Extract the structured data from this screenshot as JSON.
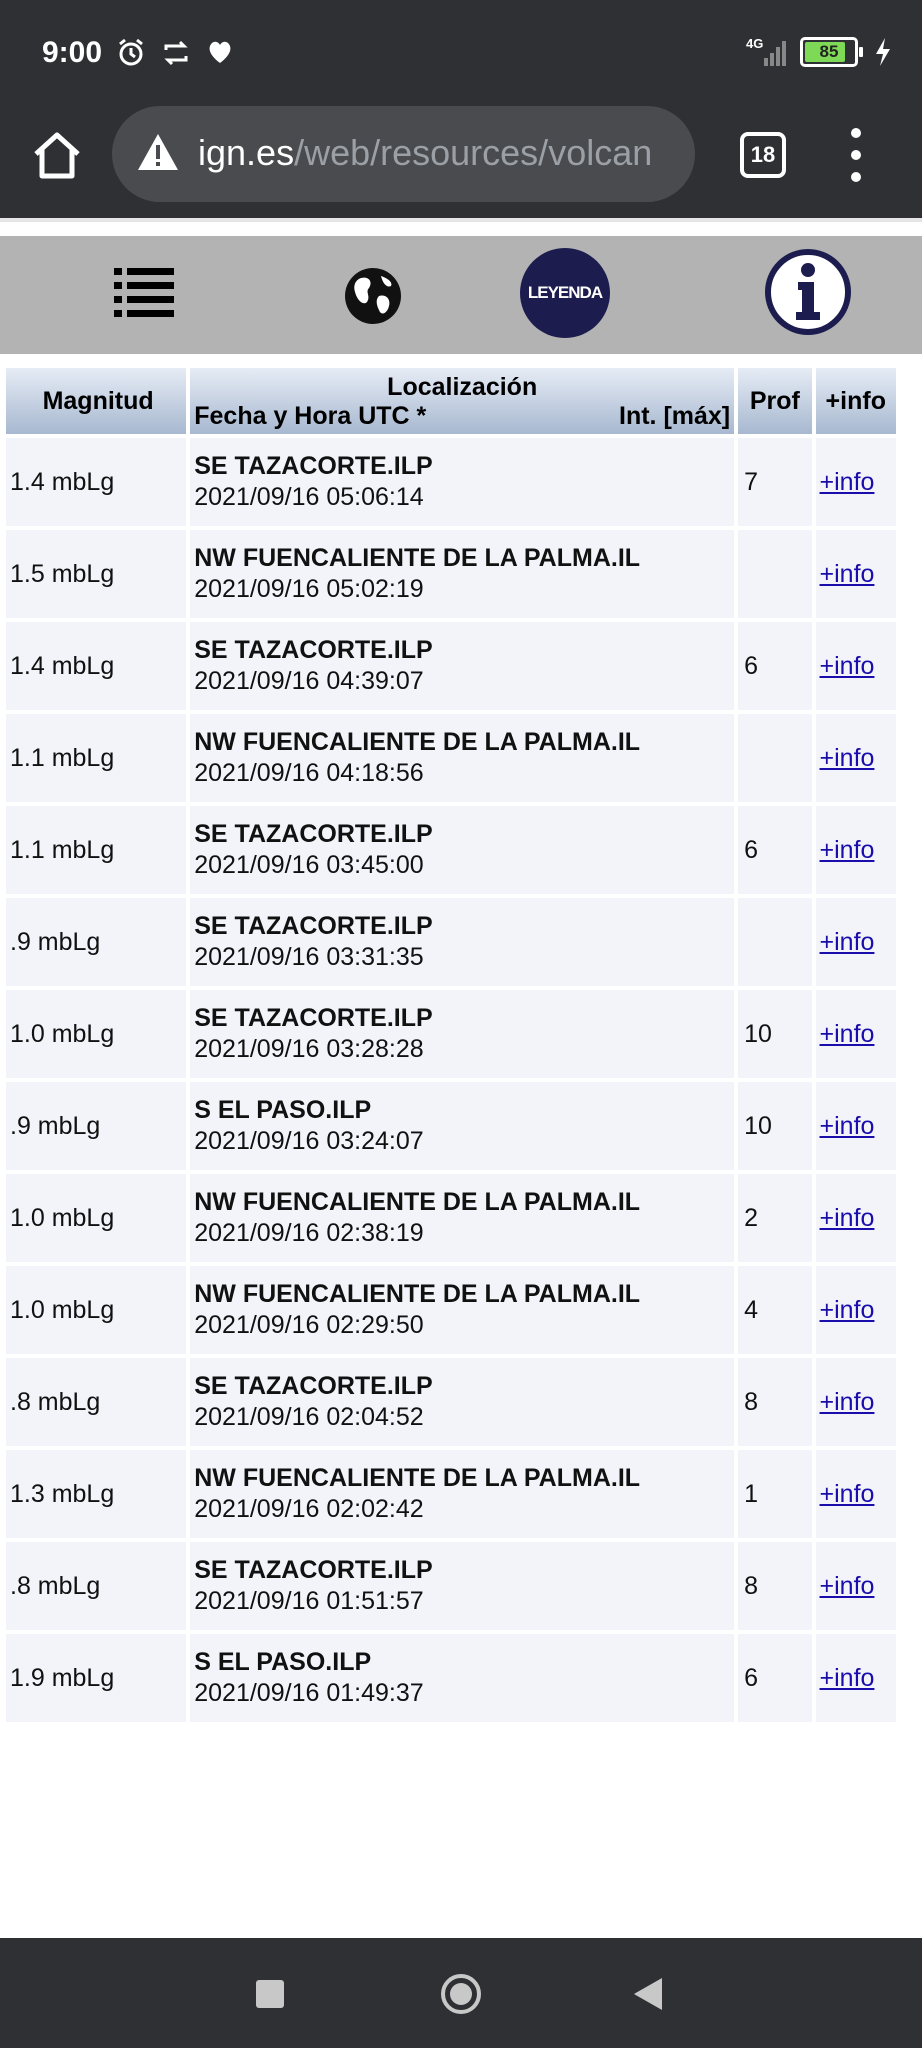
{
  "status_bar": {
    "time": "9:00",
    "network": "4G",
    "battery": "85"
  },
  "browser": {
    "url_domain": "ign.es",
    "url_path": "/web/resources/volcan",
    "tab_count": "18"
  },
  "icon_bar": {
    "legend_label": "LEYENDA"
  },
  "table": {
    "headers": {
      "magnitude": "Magnitud",
      "location": "Localización",
      "datetime": "Fecha y Hora UTC *",
      "intensity": "Int. [máx]",
      "depth": "Prof",
      "info": "+info"
    },
    "rows": [
      {
        "magnitude": "1.4 mbLg",
        "location": "SE TAZACORTE.ILP",
        "datetime": "2021/09/16 05:06:14",
        "depth": "7",
        "info": "+info"
      },
      {
        "magnitude": "1.5 mbLg",
        "location": "NW FUENCALIENTE DE LA PALMA.IL",
        "datetime": "2021/09/16 05:02:19",
        "depth": "",
        "info": "+info"
      },
      {
        "magnitude": "1.4 mbLg",
        "location": "SE TAZACORTE.ILP",
        "datetime": "2021/09/16 04:39:07",
        "depth": "6",
        "info": "+info"
      },
      {
        "magnitude": "1.1 mbLg",
        "location": "NW FUENCALIENTE DE LA PALMA.IL",
        "datetime": "2021/09/16 04:18:56",
        "depth": "",
        "info": "+info"
      },
      {
        "magnitude": "1.1 mbLg",
        "location": "SE TAZACORTE.ILP",
        "datetime": "2021/09/16 03:45:00",
        "depth": "6",
        "info": "+info"
      },
      {
        "magnitude": ".9 mbLg",
        "location": "SE TAZACORTE.ILP",
        "datetime": "2021/09/16 03:31:35",
        "depth": "",
        "info": "+info"
      },
      {
        "magnitude": "1.0 mbLg",
        "location": "SE TAZACORTE.ILP",
        "datetime": "2021/09/16 03:28:28",
        "depth": "10",
        "info": "+info"
      },
      {
        "magnitude": ".9 mbLg",
        "location": "S EL PASO.ILP",
        "datetime": "2021/09/16 03:24:07",
        "depth": "10",
        "info": "+info"
      },
      {
        "magnitude": "1.0 mbLg",
        "location": "NW FUENCALIENTE DE LA PALMA.IL",
        "datetime": "2021/09/16 02:38:19",
        "depth": "2",
        "info": "+info"
      },
      {
        "magnitude": "1.0 mbLg",
        "location": "NW FUENCALIENTE DE LA PALMA.IL",
        "datetime": "2021/09/16 02:29:50",
        "depth": "4",
        "info": "+info"
      },
      {
        "magnitude": ".8 mbLg",
        "location": "SE TAZACORTE.ILP",
        "datetime": "2021/09/16 02:04:52",
        "depth": "8",
        "info": "+info"
      },
      {
        "magnitude": "1.3 mbLg",
        "location": "NW FUENCALIENTE DE LA PALMA.IL",
        "datetime": "2021/09/16 02:02:42",
        "depth": "1",
        "info": "+info"
      },
      {
        "magnitude": ".8 mbLg",
        "location": "SE TAZACORTE.ILP",
        "datetime": "2021/09/16 01:51:57",
        "depth": "8",
        "info": "+info"
      },
      {
        "magnitude": "1.9 mbLg",
        "location": "S EL PASO.ILP",
        "datetime": "2021/09/16 01:49:37",
        "depth": "6",
        "info": "+info"
      }
    ]
  }
}
